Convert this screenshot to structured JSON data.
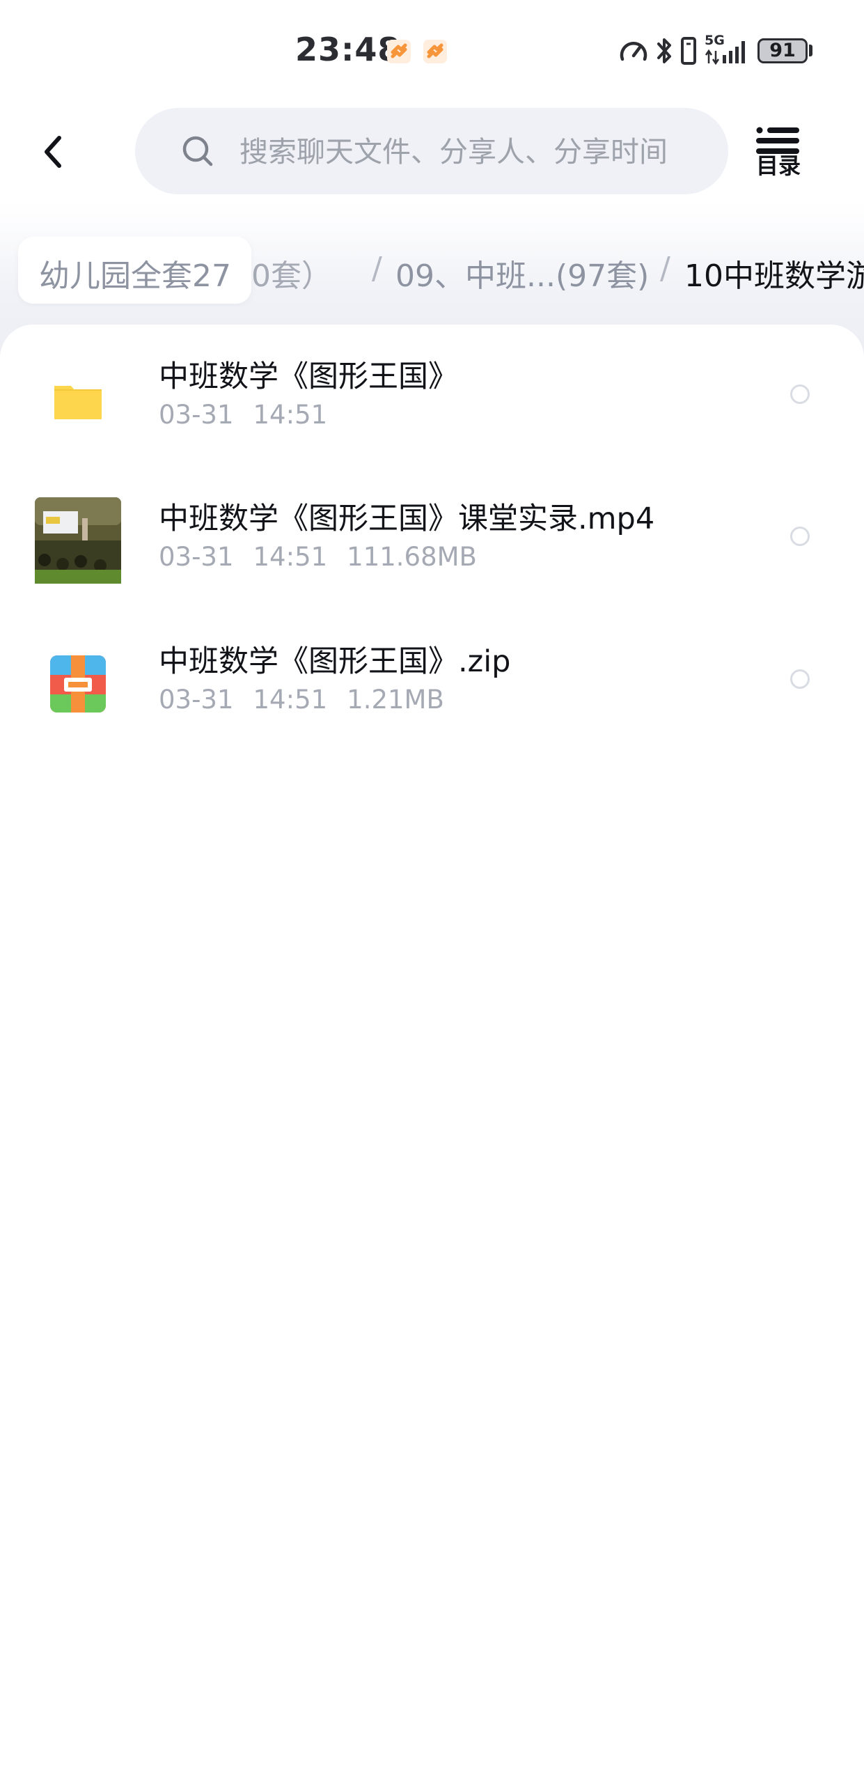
{
  "status_bar": {
    "time": "23:48",
    "battery_level": "91",
    "network_label": "5G",
    "icons": [
      "speed-icon",
      "bluetooth-icon",
      "vibrate-icon",
      "signal-icon",
      "battery-icon"
    ]
  },
  "header": {
    "search_placeholder": "搜索聊天文件、分享人、分享时间",
    "catalog_label": "目录"
  },
  "breadcrumb": {
    "items": [
      "幼儿园全套27",
      "0套）",
      "09、中班...(97套)",
      "10中班数学游"
    ],
    "separator": "/"
  },
  "files": [
    {
      "name": "中班数学《图形王国》",
      "date": "03-31",
      "time": "14:51",
      "size": "",
      "type": "folder"
    },
    {
      "name": "中班数学《图形王国》课堂实录.mp4",
      "date": "03-31",
      "time": "14:51",
      "size": "111.68MB",
      "type": "video"
    },
    {
      "name": "中班数学《图形王国》.zip",
      "date": "03-31",
      "time": "14:51",
      "size": "1.21MB",
      "type": "zip"
    }
  ],
  "colors": {
    "folder": "#fdd64d",
    "notification": "#f7953a",
    "placeholder": "#9ea2ab",
    "meta_text": "#a4a9b3"
  }
}
